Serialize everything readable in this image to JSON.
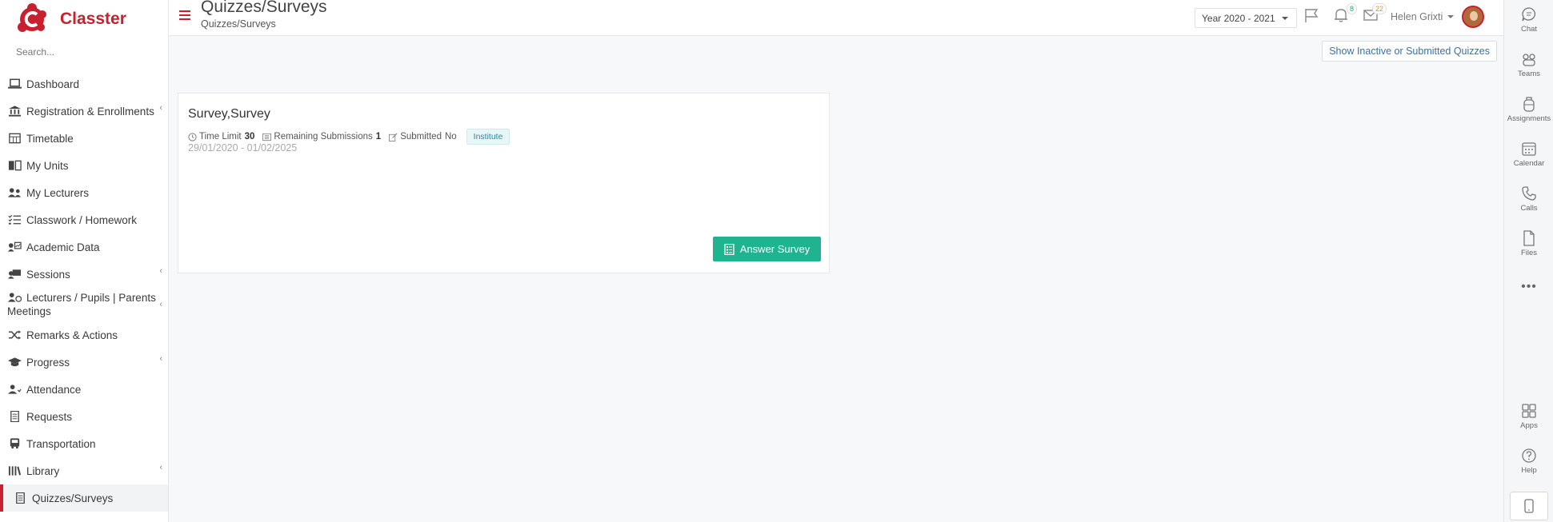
{
  "brand": {
    "name": "Classter",
    "color": "#c8202e"
  },
  "search": {
    "placeholder": "Search..."
  },
  "sidebar": {
    "items": [
      {
        "label": "Dashboard",
        "icon": "laptop-icon"
      },
      {
        "label": "Registration & Enrollments",
        "icon": "institution-icon"
      },
      {
        "label": "Timetable",
        "icon": "calendar-grid-icon"
      },
      {
        "label": "My Units",
        "icon": "book-icon"
      },
      {
        "label": "My Lecturers",
        "icon": "users-icon"
      },
      {
        "label": "Classwork / Homework",
        "icon": "checklist-icon"
      },
      {
        "label": "Academic Data",
        "icon": "user-chart-icon"
      },
      {
        "label": "Sessions",
        "icon": "sessions-icon"
      },
      {
        "label": "Lecturers / Pupils | Parents Meetings",
        "icon": "meeting-icon"
      },
      {
        "label": "Remarks & Actions",
        "icon": "shuffle-icon"
      },
      {
        "label": "Progress",
        "icon": "graduation-cap-icon"
      },
      {
        "label": "Attendance",
        "icon": "user-check-icon"
      },
      {
        "label": "Requests",
        "icon": "document-icon"
      },
      {
        "label": "Transportation",
        "icon": "bus-icon"
      },
      {
        "label": "Library",
        "icon": "library-icon"
      },
      {
        "label": "Quizzes/Surveys",
        "icon": "quiz-icon"
      }
    ]
  },
  "header": {
    "title": "Quizzes/Surveys",
    "breadcrumb": "Quizzes/Surveys",
    "year": "Year 2020 - 2021",
    "notifications_count": "8",
    "messages_count": "22",
    "user_name": "Helen Grixti"
  },
  "subbar": {
    "inactive_button": "Show Inactive or Submitted Quizzes"
  },
  "card": {
    "title": "Survey,Survey",
    "time_limit_label": "Time Limit",
    "time_limit_value": "30",
    "remaining_label": "Remaining Submissions",
    "remaining_value": "1",
    "submitted_label": "Submitted",
    "submitted_value": "No",
    "tag": "Institute",
    "dates": "29/01/2020 - 01/02/2025",
    "answer_button": "Answer Survey",
    "accent": "#1fb390"
  },
  "rail": {
    "items": [
      {
        "label": "Chat",
        "icon": "chat-icon"
      },
      {
        "label": "Teams",
        "icon": "teams-icon"
      },
      {
        "label": "Assignments",
        "icon": "backpack-icon"
      },
      {
        "label": "Calendar",
        "icon": "calendar-icon"
      },
      {
        "label": "Calls",
        "icon": "phone-icon"
      },
      {
        "label": "Files",
        "icon": "file-icon"
      },
      {
        "label": "Apps",
        "icon": "apps-icon"
      },
      {
        "label": "Help",
        "icon": "help-icon"
      }
    ]
  }
}
